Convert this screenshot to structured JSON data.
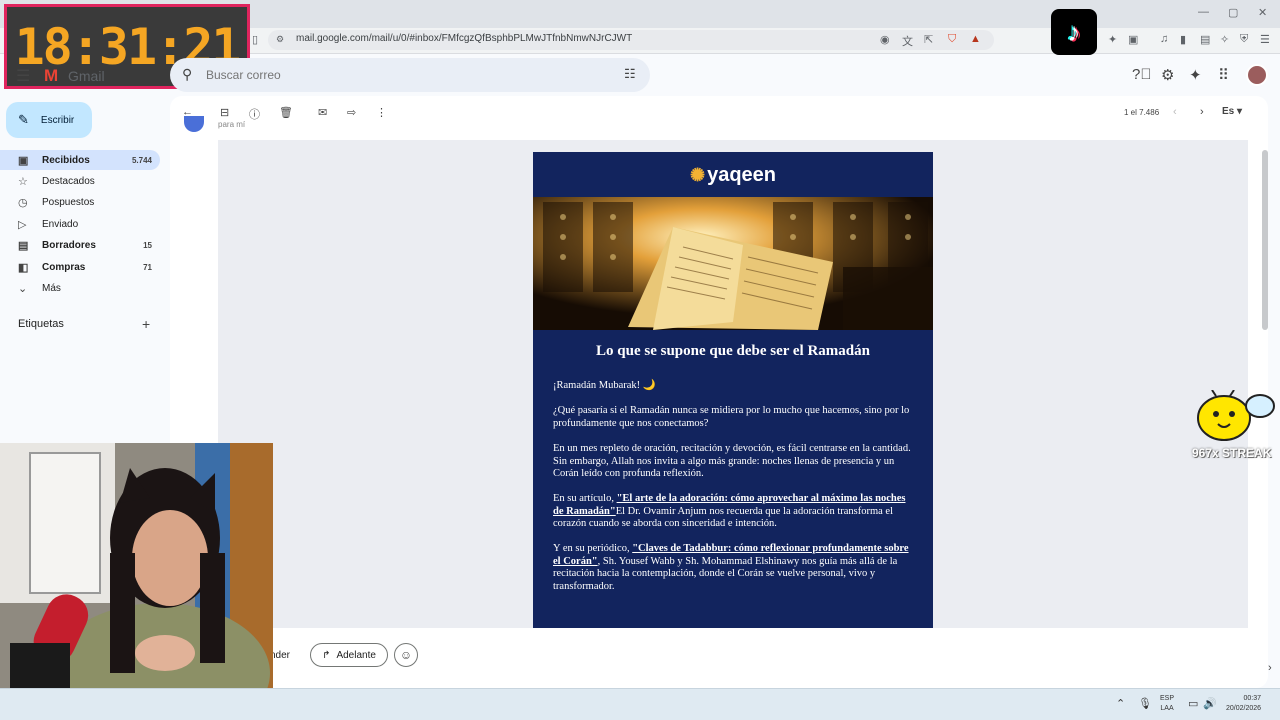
{
  "timer": {
    "text": "18:31:21"
  },
  "browser": {
    "url": "mail.google.com/mail/u/0/#inbox/FMfcgzQfBsphbPLMwJTfnbNmwNJrCJWT",
    "tiktok_glyph": "♪"
  },
  "gmail": {
    "logo_text": "Gmail",
    "search_placeholder": "Buscar correo",
    "compose_label": "Escribir",
    "nav": [
      {
        "icon": "inbox-icon",
        "glyph": "▣",
        "label": "Recibidos",
        "count": "5.744"
      },
      {
        "icon": "star-icon",
        "glyph": "☆",
        "label": "Destacados",
        "count": ""
      },
      {
        "icon": "clock-icon",
        "glyph": "◷",
        "label": "Pospuestos",
        "count": ""
      },
      {
        "icon": "send-icon",
        "glyph": "▷",
        "label": "Enviado",
        "count": ""
      },
      {
        "icon": "draft-icon",
        "glyph": "▤",
        "label": "Borradores",
        "count": "15"
      },
      {
        "icon": "tag-icon",
        "glyph": "◧",
        "label": "Compras",
        "count": "71"
      },
      {
        "icon": "chevron-down-icon",
        "glyph": "⌄",
        "label": "Más",
        "count": ""
      }
    ],
    "labels_heading": "Etiquetas",
    "pager_text": "1 el 7.486",
    "lang_label": "Es",
    "sender_to": "para mí"
  },
  "email": {
    "brand": "yaqeen",
    "title": "Lo que se supone que debe ser el Ramadán",
    "greeting": "¡Ramadán Mubarak! 🌙",
    "p1": "¿Qué pasaría si el Ramadán nunca se midiera por lo mucho que hacemos, sino por lo profundamente que nos conectamos?",
    "p2": "En un mes repleto de oración, recitación y devoción, es fácil centrarse en la cantidad. Sin embargo, Allah nos invita a algo más grande: noches llenas de presencia y un Corán leído con profunda reflexión.",
    "p3_intro": "En su artículo, ",
    "p3_link": "\"El arte de la adoración: cómo aprovechar al máximo las noches de Ramadán\"",
    "p3_rest": "El Dr. Ovamir Anjum nos recuerda que la adoración transforma el corazón cuando se aborda con sinceridad e intención.",
    "p4_intro": "Y en su periódico, ",
    "p4_link": "\"Claves de Tadabbur: cómo reflexionar profundamente sobre el Corán\"",
    "p4_rest": ", Sh. Yousef Wahb y Sh. Mohammad Elshinawy nos guía más allá de la recitación hacia la contemplación, donde el Corán se vuelve personal, vivo y transformador."
  },
  "actions": {
    "reply_label": "nder",
    "forward_label": "Adelante"
  },
  "overlay": {
    "streak": "967x STREAK"
  },
  "taskbar": {
    "lang1": "ESP",
    "lang2": "LAA",
    "time": "00:37",
    "date": "20/02/2026"
  }
}
